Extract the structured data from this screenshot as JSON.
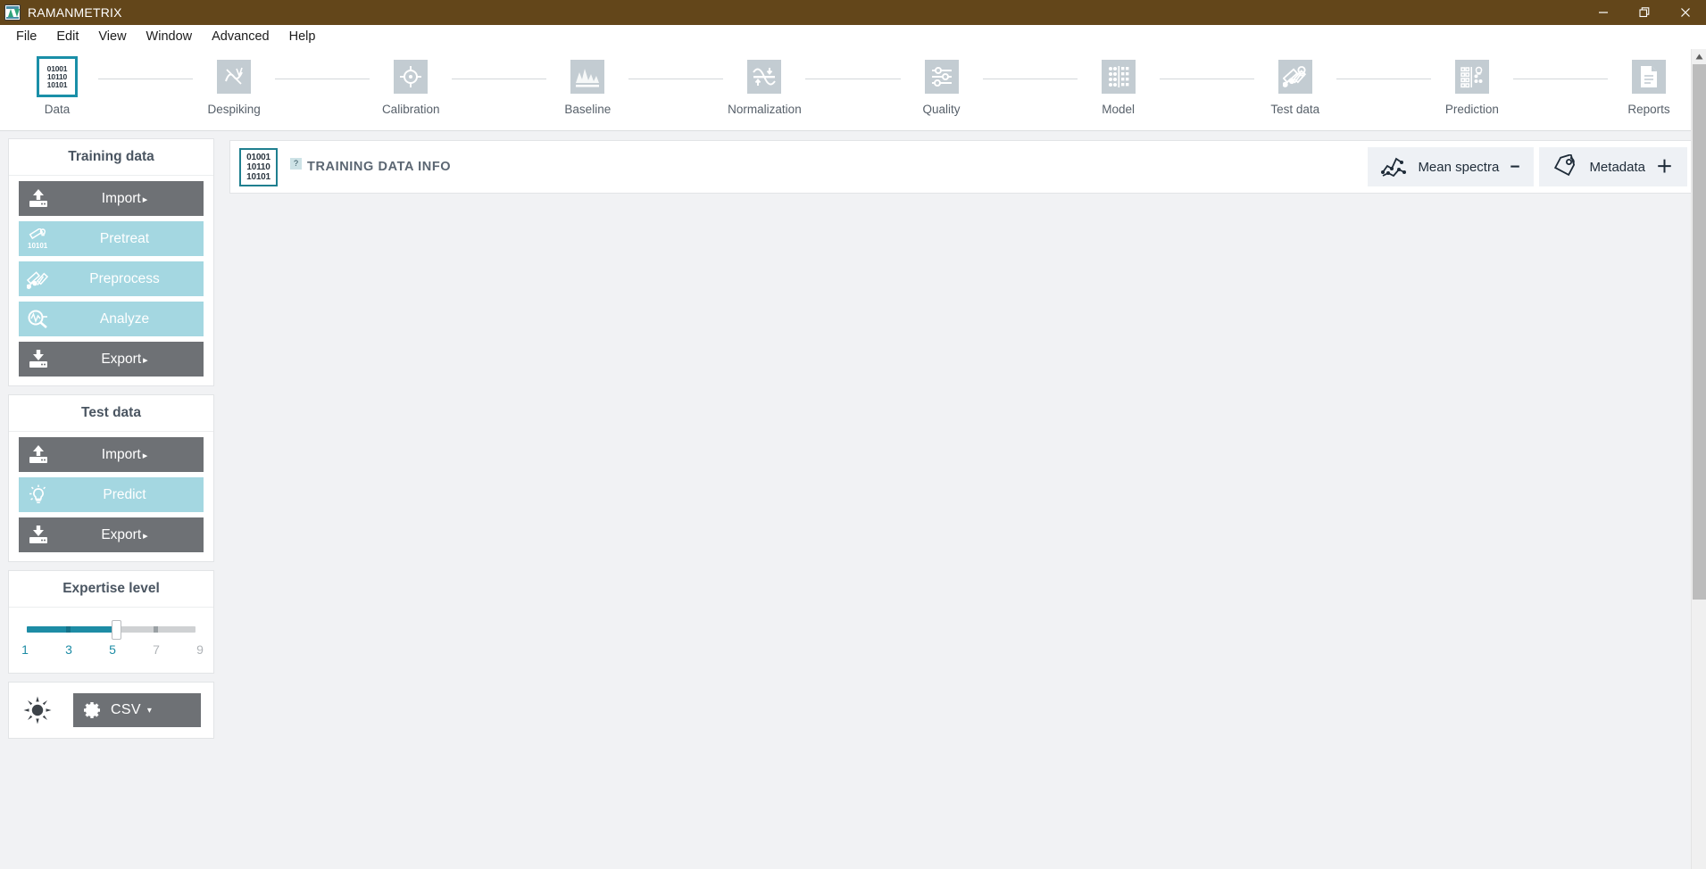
{
  "titlebar": {
    "app_name": "RAMANMETRIX",
    "icon": "app-logo-icon",
    "minimize": "minimize-icon",
    "maximize": "restore-icon",
    "close": "close-icon",
    "bg_color": "#63461a"
  },
  "menubar": {
    "items": [
      {
        "label": "File"
      },
      {
        "label": "Edit"
      },
      {
        "label": "View"
      },
      {
        "label": "Window"
      },
      {
        "label": "Advanced"
      },
      {
        "label": "Help"
      }
    ]
  },
  "workflow": {
    "active_step": "Data",
    "active_color": "#1a8fa8",
    "steps": [
      {
        "label": "Data",
        "icon": "binary-data-icon",
        "active": true
      },
      {
        "label": "Despiking",
        "icon": "despiking-icon",
        "active": false
      },
      {
        "label": "Calibration",
        "icon": "crosshair-icon",
        "active": false
      },
      {
        "label": "Baseline",
        "icon": "baseline-chart-icon",
        "active": false
      },
      {
        "label": "Normalization",
        "icon": "normalization-icon",
        "active": false
      },
      {
        "label": "Quality",
        "icon": "sliders-icon",
        "active": false
      },
      {
        "label": "Model",
        "icon": "model-matrix-icon",
        "active": false
      },
      {
        "label": "Test data",
        "icon": "test-data-icon",
        "active": false
      },
      {
        "label": "Prediction",
        "icon": "prediction-icon",
        "active": false
      },
      {
        "label": "Reports",
        "icon": "report-document-icon",
        "active": false
      }
    ]
  },
  "sidebar": {
    "training_panel": {
      "title": "Training data",
      "buttons": [
        {
          "label": "Import",
          "caret": "▸",
          "style": "gray",
          "icon": "import-upload-icon"
        },
        {
          "label": "Pretreat",
          "caret": "",
          "style": "teal",
          "icon": "pretreat-icon"
        },
        {
          "label": "Preprocess",
          "caret": "",
          "style": "teal",
          "icon": "preprocess-icon"
        },
        {
          "label": "Analyze",
          "caret": "",
          "style": "teal",
          "icon": "analyze-magnifier-icon"
        },
        {
          "label": "Export",
          "caret": "▸",
          "style": "gray",
          "icon": "export-download-icon"
        }
      ]
    },
    "test_panel": {
      "title": "Test data",
      "buttons": [
        {
          "label": "Import",
          "caret": "▸",
          "style": "gray",
          "icon": "import-upload-icon"
        },
        {
          "label": "Predict",
          "caret": "",
          "style": "teal",
          "icon": "lightbulb-icon"
        },
        {
          "label": "Export",
          "caret": "▸",
          "style": "gray",
          "icon": "export-download-icon"
        }
      ]
    },
    "expertise_panel": {
      "title": "Expertise level",
      "value": 5,
      "min": 1,
      "max": 9,
      "tick_labels": [
        {
          "label": "1",
          "value": 1,
          "active": true
        },
        {
          "label": "3",
          "value": 3,
          "active": true
        },
        {
          "label": "5",
          "value": 5,
          "active": true
        },
        {
          "label": "7",
          "value": 7,
          "active": false
        },
        {
          "label": "9",
          "value": 9,
          "active": false
        }
      ],
      "fill_color": "#1d8ca5",
      "track_color": "#cfd1d3"
    },
    "bottom_panel": {
      "theme_icon": "sun-brightness-icon",
      "settings_icon": "gear-icon",
      "format_label": "CSV",
      "format_caret": "▾"
    },
    "button_colors": {
      "gray": "#6e7175",
      "teal": "#a4d7e1"
    }
  },
  "main": {
    "info_card": {
      "badge_icon": "binary-data-icon",
      "badge_lines": [
        "01001",
        "10110",
        "10101"
      ],
      "help_label": "?",
      "title": "TRAINING DATA INFO",
      "actions": [
        {
          "label": "Mean spectra",
          "sign": "−",
          "icon": "spectra-chart-icon"
        },
        {
          "label": "Metadata",
          "sign": "＋",
          "icon": "tag-icon"
        }
      ]
    }
  },
  "scrollbar": {
    "up_arrow": "scroll-up-arrow-icon",
    "thumb": "scrollbar-thumb"
  }
}
